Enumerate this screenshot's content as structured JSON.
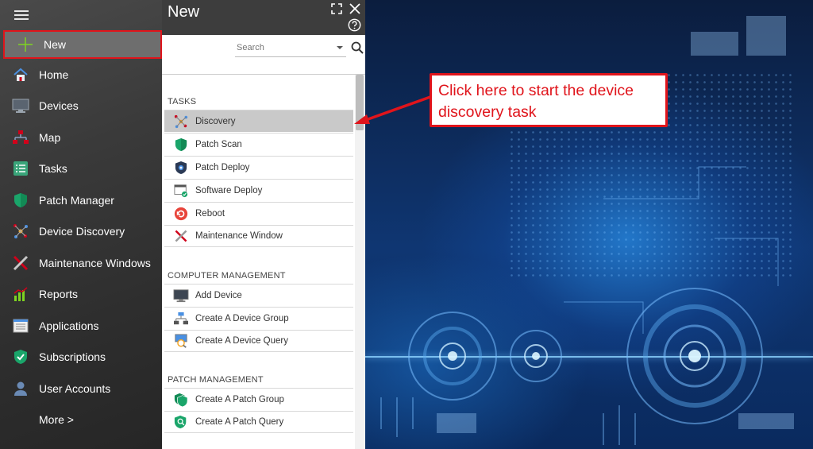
{
  "sidebar": {
    "items": [
      {
        "label": "New",
        "icon": "plus-icon"
      },
      {
        "label": "Home",
        "icon": "home-icon"
      },
      {
        "label": "Devices",
        "icon": "monitor-icon"
      },
      {
        "label": "Map",
        "icon": "map-icon"
      },
      {
        "label": "Tasks",
        "icon": "tasks-icon"
      },
      {
        "label": "Patch Manager",
        "icon": "shield-icon"
      },
      {
        "label": "Device Discovery",
        "icon": "discovery-icon"
      },
      {
        "label": "Maintenance Windows",
        "icon": "tools-icon"
      },
      {
        "label": "Reports",
        "icon": "bar-chart-icon"
      },
      {
        "label": "Applications",
        "icon": "applications-icon"
      },
      {
        "label": "Subscriptions",
        "icon": "subscriptions-icon"
      },
      {
        "label": "User Accounts",
        "icon": "user-icon"
      },
      {
        "label": "More >",
        "icon": ""
      }
    ]
  },
  "panel": {
    "title": "New",
    "search": {
      "placeholder": "Search",
      "value": ""
    },
    "sections": [
      {
        "heading": "TASKS",
        "items": [
          {
            "label": "Discovery",
            "icon": "discovery-icon",
            "selected": true
          },
          {
            "label": "Patch Scan",
            "icon": "shield-icon"
          },
          {
            "label": "Patch Deploy",
            "icon": "patch-deploy-icon"
          },
          {
            "label": "Software Deploy",
            "icon": "software-deploy-icon"
          },
          {
            "label": "Reboot",
            "icon": "reboot-icon"
          },
          {
            "label": "Maintenance Window",
            "icon": "tools-icon"
          }
        ]
      },
      {
        "heading": "COMPUTER MANAGEMENT",
        "items": [
          {
            "label": "Add Device",
            "icon": "monitor-icon"
          },
          {
            "label": "Create A Device Group",
            "icon": "device-group-icon"
          },
          {
            "label": "Create A Device Query",
            "icon": "device-query-icon"
          }
        ]
      },
      {
        "heading": "PATCH MANAGEMENT",
        "items": [
          {
            "label": "Create A Patch Group",
            "icon": "patch-group-icon"
          },
          {
            "label": "Create A Patch Query",
            "icon": "patch-query-icon"
          }
        ]
      }
    ]
  },
  "callout": {
    "line1": "Click here to start the device",
    "line2": "discovery task"
  },
  "colors": {
    "highlight_red": "#e0141b",
    "sidebar_bg": "#3a3a3a",
    "selected_item": "#c9c9c9"
  }
}
